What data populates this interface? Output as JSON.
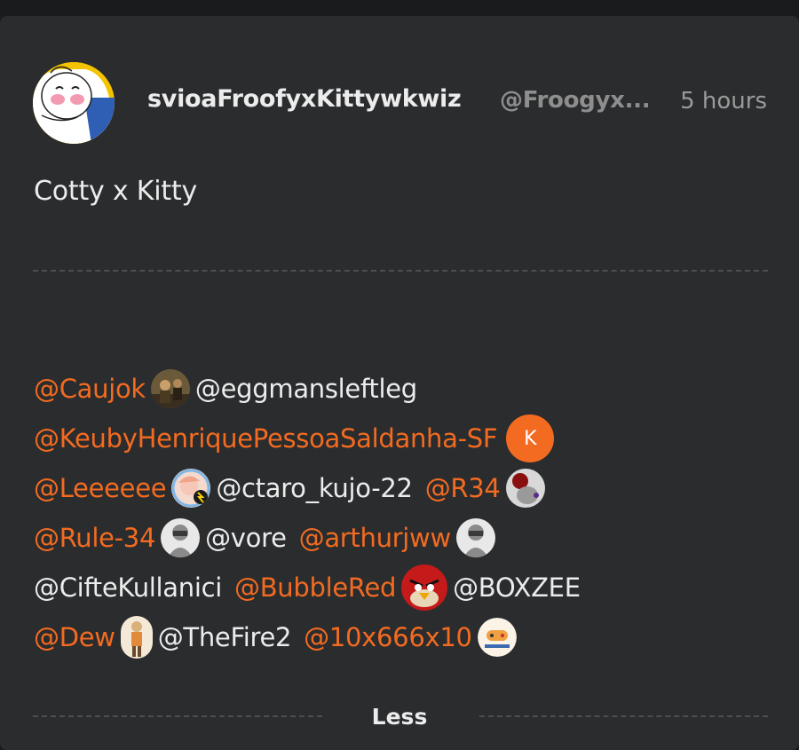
{
  "post": {
    "author_name": "svioaFroofyxKittywkwiz",
    "author_handle": "@Froogyx...",
    "time": "5 hours",
    "text": "Cotty x Kitty",
    "less_label": "Less"
  },
  "mentions": {
    "caujok": "@Caujok",
    "eggmansleftleg": "@eggmansleftleg",
    "keuby": "@KeubyHenriquePessoaSaldanha-SF",
    "keuby_initial": "K",
    "leeeeee": "@Leeeeee",
    "ctaro": "@ctaro_kujo-22",
    "r34": "@R34",
    "rule34": "@Rule-34",
    "vore": "@vore",
    "arthurjww": "@arthurjww",
    "cifte": "@CifteKullanici",
    "bubblered": "@BubbleRed",
    "boxzee": "@BOXZEE",
    "dew": "@Dew",
    "thefire2": "@TheFire2",
    "tenx": "@10x666x10"
  },
  "colors": {
    "background": "#2a2c2e",
    "mention_accent": "#f36b21",
    "text": "#ececec",
    "muted": "#8e8e8e"
  }
}
